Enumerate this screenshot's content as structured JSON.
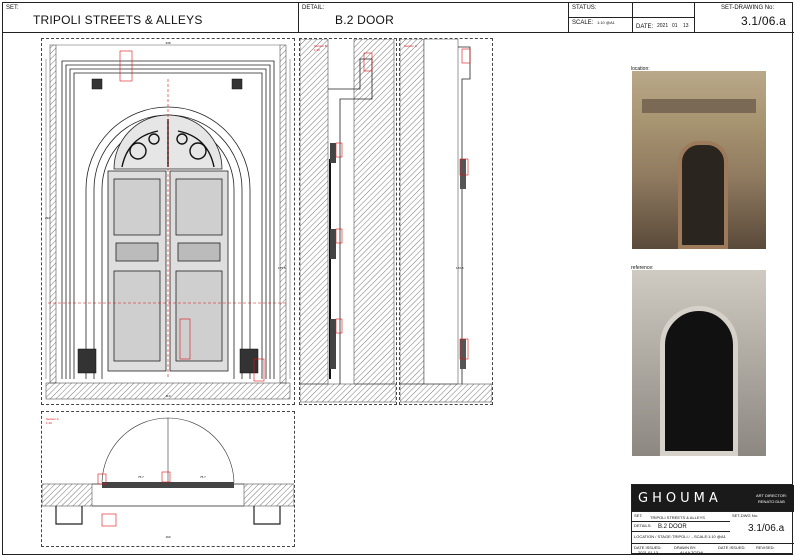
{
  "titleblock": {
    "set_label": "SET:",
    "set_value": "TRIPOLI STREETS & ALLEYS",
    "detail_label": "DETAIL:",
    "detail_value": "B.2 DOOR",
    "status_label": "STATUS:",
    "scale_label": "SCALE:",
    "scale_value": "1:10 @A1",
    "date_label": "DATE:",
    "date_value": [
      "2021",
      "01",
      "13"
    ],
    "drawing_label": "SET-DRAWING No:",
    "drawing_value": "3.1/06.a"
  },
  "drawing": {
    "elevation": {
      "dims_top": [
        "338",
        "64",
        "160",
        "64",
        "42"
      ],
      "dims_left": [
        "292",
        "240"
      ],
      "dims_right": [
        "292",
        "175.5"
      ],
      "dims_bottom": [
        "27",
        "23.5",
        "110",
        "23.5",
        "27"
      ]
    },
    "section_b": {
      "label": "Section B",
      "scale": "1:10",
      "dims": [
        "32.5",
        "60.5",
        "18.5",
        "620",
        "206.5",
        "66.5"
      ]
    },
    "section_c": {
      "label": "Section C",
      "scale": "1:10",
      "dims": [
        "11.5",
        "66.2",
        "170.5",
        "40.7"
      ]
    },
    "section_a": {
      "label": "Section A",
      "scale": "1:10",
      "dims": [
        "75.7",
        "75.7",
        "98",
        "28.6",
        "65",
        "160",
        "65",
        "117.5"
      ]
    }
  },
  "photos": [
    {
      "label": "location:",
      "colors": [
        "#b9a88a",
        "#8f7a60",
        "#5a4a3a",
        "#2b2520"
      ]
    },
    {
      "label": "reference:",
      "colors": [
        "#cfcac2",
        "#8c8881",
        "#2e2a27",
        "#111111"
      ]
    }
  ],
  "stamp": {
    "logo": "GHOUMA",
    "art_director_label": "ART DIRECTOR:",
    "art_director_value": "RENATO DIAB",
    "set_label": "SET:",
    "set_value": "TRIPOLI STREETS & ALLEYS",
    "drawing_label": "SET-DWG No:",
    "drawing_value": "3.1/06.a",
    "details_label": "DETAILS:",
    "details_value": "B.2 DOOR",
    "location_label": "LOCATION / STAGE:",
    "location_value": "TRIPOLI / ...",
    "scale_label": "SCALE:",
    "scale_value": "1:10 @A1",
    "date_label": "DATE ISSUED:",
    "date_value": "2021.01.13",
    "drawn_label": "DRAWN BY:",
    "drawn_value": "ALAA TOTHI",
    "dateissued_label": "DATE ISSUED:",
    "revised_label": "REVISED:"
  }
}
